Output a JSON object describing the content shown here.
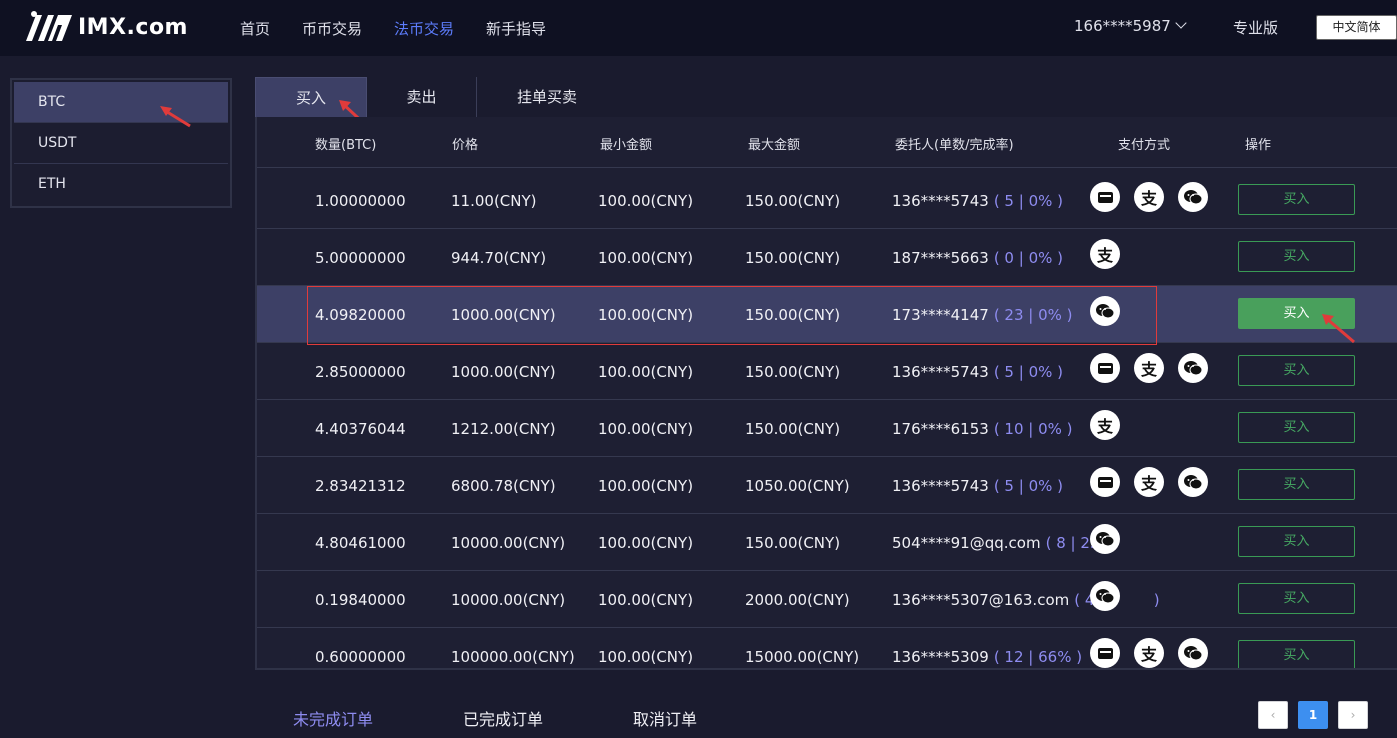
{
  "header": {
    "logo_text": "IMX.com",
    "nav": [
      "首页",
      "币币交易",
      "法币交易",
      "新手指导"
    ],
    "active_nav": 2,
    "user": "166****5987",
    "pro": "专业版",
    "lang": "中文简体"
  },
  "coins": [
    "BTC",
    "USDT",
    "ETH"
  ],
  "tabs": [
    "买入",
    "卖出",
    "挂单买卖"
  ],
  "columns": [
    "数量(BTC)",
    "价格",
    "最小金额",
    "最大金额",
    "委托人(单数/完成率)",
    "支付方式",
    "操作"
  ],
  "rows": [
    {
      "qty": "1.00000000",
      "price": "11.00(CNY)",
      "min": "100.00(CNY)",
      "max": "150.00(CNY)",
      "user": "136****5743",
      "stats": "( 5 | 0% )",
      "pays": [
        "card-icon",
        "alipay-icon",
        "wechat-icon"
      ],
      "action": "买入"
    },
    {
      "qty": "5.00000000",
      "price": "944.70(CNY)",
      "min": "100.00(CNY)",
      "max": "150.00(CNY)",
      "user": "187****5663",
      "stats": "( 0 | 0% )",
      "pays": [
        "alipay-icon"
      ],
      "action": "买入"
    },
    {
      "qty": "4.09820000",
      "price": "1000.00(CNY)",
      "min": "100.00(CNY)",
      "max": "150.00(CNY)",
      "user": "173****4147",
      "stats": "( 23 | 0% )",
      "pays": [
        "wechat-icon"
      ],
      "action": "买入"
    },
    {
      "qty": "2.85000000",
      "price": "1000.00(CNY)",
      "min": "100.00(CNY)",
      "max": "150.00(CNY)",
      "user": "136****5743",
      "stats": "( 5 | 0% )",
      "pays": [
        "card-icon",
        "alipay-icon",
        "wechat-icon"
      ],
      "action": "买入"
    },
    {
      "qty": "4.40376044",
      "price": "1212.00(CNY)",
      "min": "100.00(CNY)",
      "max": "150.00(CNY)",
      "user": "176****6153",
      "stats": "( 10 | 0% )",
      "pays": [
        "alipay-icon"
      ],
      "action": "买入"
    },
    {
      "qty": "2.83421312",
      "price": "6800.78(CNY)",
      "min": "100.00(CNY)",
      "max": "1050.00(CNY)",
      "user": "136****5743",
      "stats": "( 5 | 0% )",
      "pays": [
        "card-icon",
        "alipay-icon",
        "wechat-icon"
      ],
      "action": "买入"
    },
    {
      "qty": "4.80461000",
      "price": "10000.00(CNY)",
      "min": "100.00(CNY)",
      "max": "150.00(CNY)",
      "user": "504****91@qq.com",
      "stats": "( 8 | 25%",
      "pays": [
        "wechat-icon"
      ],
      "action": "买入"
    },
    {
      "qty": "0.19840000",
      "price": "10000.00(CNY)",
      "min": "100.00(CNY)",
      "max": "2000.00(CNY)",
      "user": "136****5307@163.com",
      "stats": "( 41 |",
      "stats_tail": ")",
      "pays": [
        "wechat-icon"
      ],
      "action": "买入"
    },
    {
      "qty": "0.60000000",
      "price": "100000.00(CNY)",
      "min": "100.00(CNY)",
      "max": "15000.00(CNY)",
      "user": "136****5309",
      "stats": "( 12 | 66% )",
      "pays": [
        "card-icon",
        "alipay-icon",
        "wechat-icon"
      ],
      "action": "买入"
    }
  ],
  "bottom_tabs": [
    "未完成订单",
    "已完成订单",
    "取消订单"
  ],
  "pagination": {
    "prev": "‹",
    "current": "1",
    "next": "›"
  },
  "colors": {
    "accent": "#5c7cfa",
    "buy_green": "#49a05c",
    "highlight": "#3d4066",
    "annotation_red": "#e03b3b"
  }
}
